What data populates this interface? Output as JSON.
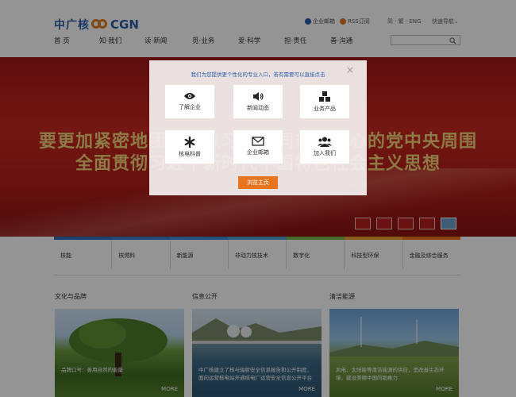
{
  "header": {
    "logo_cn": "中广核",
    "logo_en": "CGN",
    "toplinks": [
      "企业邮箱",
      "RSS订阅"
    ],
    "lang": "简 · 繁 · ENG",
    "quick_nav": "快速导航"
  },
  "nav": [
    "首 页",
    "知·我们",
    "读·新闻",
    "觅·业务",
    "爱·科学",
    "担·责任",
    "善·沟通"
  ],
  "search": {
    "placeholder": ""
  },
  "banner": {
    "line1": "要更加紧密地团结在以习近平同志为核心的党中央周围",
    "line2": "全面贯彻习近平新时代中国特色社会主义思想"
  },
  "business": [
    "核能",
    "核燃料",
    "新能源",
    "非动力核技术",
    "数字化",
    "科技型环保",
    "金融及综合服务"
  ],
  "colors": {
    "accent": "#e8741e",
    "brand": "#2a5ea8",
    "banner": "#c0261e",
    "bar": [
      "#2f6fb8",
      "#3a7cc4",
      "#3b8ed0",
      "#4aa0d8",
      "#7ab648",
      "#f0a030",
      "#e8741e"
    ]
  },
  "columns": [
    {
      "title": "文化与品牌",
      "caption": "品牌口号：善用自然的能量",
      "more": "MORE"
    },
    {
      "title": "信息公开",
      "caption": "中广核建立了核与辐射安全信息报告和公开制度，面向运营核电站开通核电厂运营安全信息公开平台",
      "more": "MORE"
    },
    {
      "title": "清洁能源",
      "caption": "风电、太阳能等清洁能源的供应，是改善生态环境，建设美丽中国的助推力",
      "more": "MORE"
    }
  ],
  "modal": {
    "message": "我们为您提供更个性化的专业入口，若有需要可以直接点击",
    "tiles": [
      {
        "label": "了解企业",
        "icon": "eye-icon"
      },
      {
        "label": "新闻动态",
        "icon": "speaker-icon"
      },
      {
        "label": "业务产品",
        "icon": "cubes-icon"
      },
      {
        "label": "核电科普",
        "icon": "asterisk-icon"
      },
      {
        "label": "企业邮箱",
        "icon": "envelope-icon"
      },
      {
        "label": "加入我们",
        "icon": "users-icon"
      }
    ],
    "browse": "浏览主页",
    "close": "×"
  }
}
